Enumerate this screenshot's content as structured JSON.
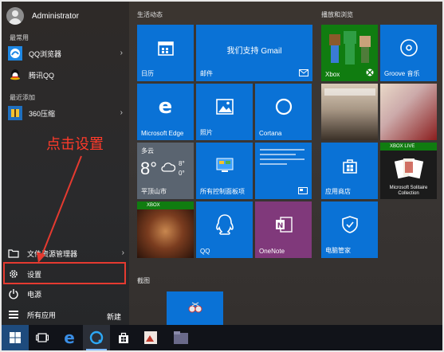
{
  "user": {
    "name": "Administrator"
  },
  "left": {
    "most_used_header": "最常用",
    "most_used": [
      {
        "label": "QQ浏览器",
        "icon": "qq-browser-icon"
      },
      {
        "label": "腾讯QQ",
        "icon": "qq-penguin-icon"
      }
    ],
    "recent_header": "最近添加",
    "recent": [
      {
        "label": "360压缩",
        "icon": "360-zip-icon"
      }
    ],
    "system": [
      {
        "label": "文件资源管理器",
        "icon": "folder-icon"
      },
      {
        "label": "设置",
        "icon": "gear-icon"
      },
      {
        "label": "电源",
        "icon": "power-icon"
      },
      {
        "label": "所有应用",
        "icon": "list-icon"
      }
    ],
    "new_label": "新建"
  },
  "annotation": {
    "text": "点击设置",
    "color": "#ff3a2a"
  },
  "groups": {
    "life": "生活动态",
    "play": "播放和浏览",
    "screenshot": "截图"
  },
  "tiles": {
    "calendar": "日历",
    "mail_msg": "我们支持 Gmail",
    "mail": "邮件",
    "xbox": "Xbox",
    "groove": "Groove 音乐",
    "edge": "Microsoft Edge",
    "photos": "照片",
    "cortana": "Cortana",
    "weather_cond": "多云",
    "weather_temp": "8°",
    "weather_hi": "8°",
    "weather_lo": "0°",
    "weather_city": "平顶山市",
    "control": "所有控制面板项",
    "store": "应用商店",
    "xbox_live": "XBOX LIVE",
    "solitaire": "Microsoft Solitaire Collection",
    "xbox_small": "XBOX",
    "qq": "QQ",
    "onenote": "OneNote",
    "pcmgr": "电脑管家"
  },
  "colors": {
    "tile_blue": "#0a72d6",
    "highlight_red": "#e53a30",
    "onenote_purple": "#80397b",
    "xbox_green": "#107c10"
  }
}
